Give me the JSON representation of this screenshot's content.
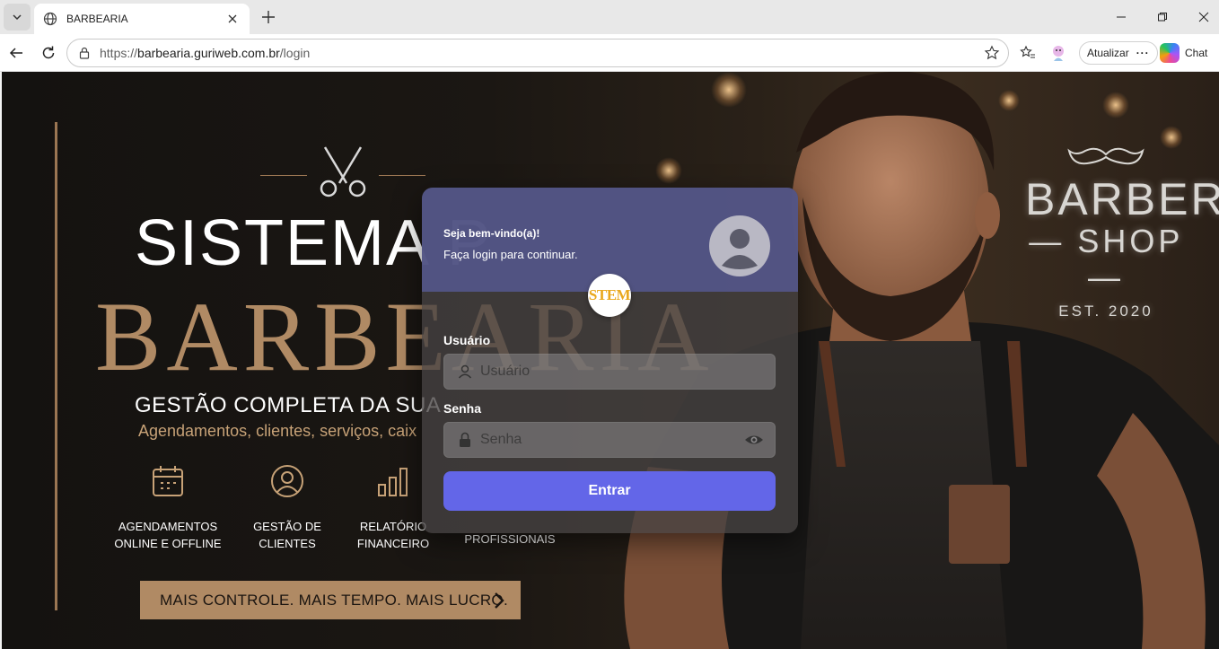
{
  "browser": {
    "tab_title": "BARBEARIA",
    "url_prefix": "https://",
    "url_host": "barbearia.guriweb.com.br",
    "url_path": "/login",
    "update_label": "Atualizar",
    "chat_label": "Chat"
  },
  "hero": {
    "line1": "SISTEMA P",
    "line2": "BARBEARIA",
    "line3": "GESTÃO COMPLETA DA SUA",
    "line4": "Agendamentos, clientes, serviços, caix",
    "features": [
      {
        "line1": "AGENDAMENTOS",
        "line2": "ONLINE E OFFLINE",
        "icon": "calendar-icon"
      },
      {
        "line1": "GESTÃO DE",
        "line2": "CLIENTES",
        "icon": "user-circle-icon"
      },
      {
        "line1": "RELATÓRIO",
        "line2": "FINANCEIRO",
        "icon": "bar-chart-icon"
      },
      {
        "line1": "",
        "line2": "PROFISSIONAIS",
        "icon": ""
      }
    ],
    "cta": "MAIS CONTROLE. MAIS TEMPO. MAIS LUCRO.",
    "sign_line1": "BARBER",
    "sign_line2": "SHOP",
    "sign_line3": "EST. 2020"
  },
  "login": {
    "welcome": "Seja bem-vindo(a)!",
    "subtitle": "Faça login para continuar.",
    "logo_text": "STEM",
    "user_label": "Usuário",
    "user_placeholder": "Usuário",
    "user_value": "",
    "pass_label": "Senha",
    "pass_placeholder": "Senha",
    "pass_value": "",
    "submit_label": "Entrar",
    "accent": "#6366e8"
  }
}
